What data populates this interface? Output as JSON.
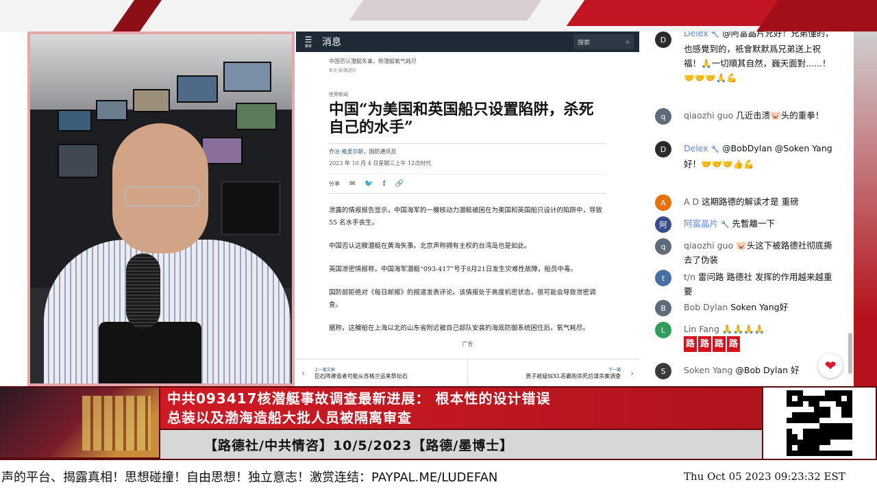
{
  "browser": {
    "menu_label": "菜单",
    "section_title": "消息",
    "search_placeholder": "搜索",
    "breadcrumb": "中国否认潜艇失事，称潜艇氧气耗尽",
    "byline_small": "斯克·德/路透社",
    "section_tag": "世界新闻",
    "headline": "中国“为美国和英国船只设置陷阱，杀死自己的水手”",
    "author_name": "乔治·格里尔斯",
    "author_org": "，国防通讯员",
    "date": "2023 年 10 月 4 日星期三上午 12点时代",
    "share_label": "分享",
    "paragraphs": [
      "泄露的情报报告显示，中国海军的一艘核动力潜艇被困在为美国和英国船只设计的陷阱中，导致 55 名水手丧生。",
      "中国否认这艘潜艇在黄海失事。北京声称拥有主权的台湾岛也是如此。",
      "英国泄密情报称，中国海军潜艇“093-417”号于8月21日发生灾难性故障，船员中毒。",
      "国防部拒绝对《每日邮报》的报道发表评论。该情报处于高度机密状态，很可能会导致泄密调查。",
      "据称，这艘船在上海以北的山东省附近被自己部队安装的海底防御系统困住后，氧气耗尽。"
    ],
    "ad_label": "广告",
    "prev_label": "上一篇文章",
    "prev_title": "巨石阵建造者可能从苏格兰运来祭坛石",
    "next_label": "下一篇",
    "next_title": "男子被疑似XL恶霸狗杀死后谋杀案调查"
  },
  "chat": {
    "messages": [
      {
        "name": "Delex",
        "avatar": "D",
        "avatar_color": "#2b2b2b",
        "text": "@阿富晶片兄好！兄弟懂的，也感覺到的，衹會默默爲兄弟送上祝福！🙏一切順其自然，巍天面對......！🤝🤝🤝🙏💪"
      },
      {
        "name": "qiaozhi guo",
        "avatar": "q",
        "avatar_color": "#5f6b78",
        "text": "几近击溃🐷头的重拳！"
      },
      {
        "name": "Delex",
        "avatar": "D",
        "avatar_color": "#2b2b2b",
        "text": "@BobDylan @Soken Yang 好！🤝🤝🤝👍💪"
      },
      {
        "name": "A D",
        "avatar": "A",
        "avatar_color": "#e8710a",
        "text": "这期路德的解读才是 重磅"
      },
      {
        "name": "阿富晶片",
        "avatar": "阿",
        "avatar_color": "#3b4e8c",
        "text": "先暫離一下"
      },
      {
        "name": "qiaozhi guo",
        "avatar": "q",
        "avatar_color": "#5f6b78",
        "text": "🐷头这下被路德社彻底撕去了伪装"
      },
      {
        "name": "t/n",
        "avatar": "t",
        "avatar_color": "#4a6fa5",
        "text": "雷问路 路德社 发挥的作用越来越重要"
      },
      {
        "name": "Bob Dylan",
        "avatar": "B",
        "avatar_color": "#5f6b78",
        "text": "Soken Yang好"
      },
      {
        "name": "Lin Fang",
        "avatar": "L",
        "avatar_color": "#2e9e5b",
        "text": "🙏🙏🙏🙏"
      },
      {
        "name": "Soken Yang",
        "avatar": "S",
        "avatar_color": "#3a3a3a",
        "text": "@Bob Dylan 好"
      }
    ],
    "chip_text": "路"
  },
  "banner": {
    "headline_line1": "中共093417核潜艇事故调查最新进展： 根本性的设计错误",
    "headline_line2": "总装以及渤海造船大批人员被隔离审查",
    "subtitle": "【路德社/中共情咨】10/5/2023【路德/墨博士】"
  },
  "ticker": {
    "text": "声的平台、揭露真相！思想碰撞！自由思想！独立意志！激赏连结：PAYPAL.ME/LUDEFAN",
    "clock": "Thu Oct 05 2023 09:23:32 EST"
  },
  "colors": {
    "brand_red": "#cf1a24",
    "nav_dark": "#1e2a35",
    "chat_name_blue": "#5e84f1"
  }
}
